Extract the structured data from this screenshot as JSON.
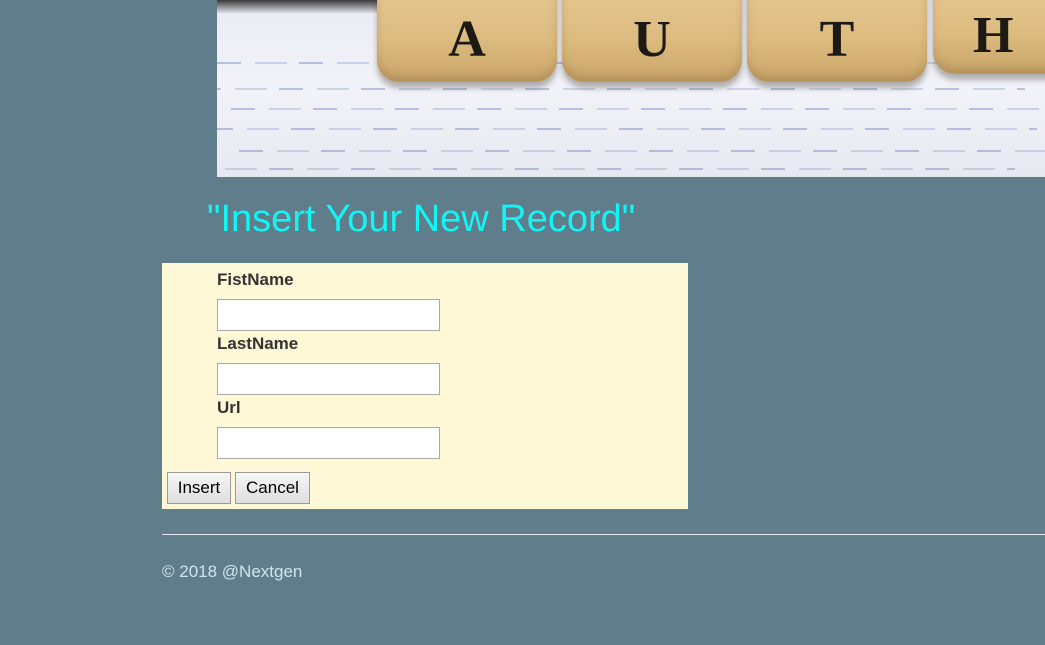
{
  "banner": {
    "image_name": "author-letter-tiles-banner",
    "letters": [
      "A",
      "U",
      "T",
      "H"
    ]
  },
  "page": {
    "heading": "\"Insert Your New Record\""
  },
  "form": {
    "fields": [
      {
        "label": "FistName",
        "value": ""
      },
      {
        "label": "LastName",
        "value": ""
      },
      {
        "label": "Url",
        "value": ""
      }
    ],
    "insert_label": "Insert",
    "cancel_label": "Cancel",
    "background_color": "#fff8d6"
  },
  "footer": {
    "text": "© 2018 @Nextgen"
  },
  "colors": {
    "page_background": "#607d8b",
    "heading": "#12f5f5"
  }
}
